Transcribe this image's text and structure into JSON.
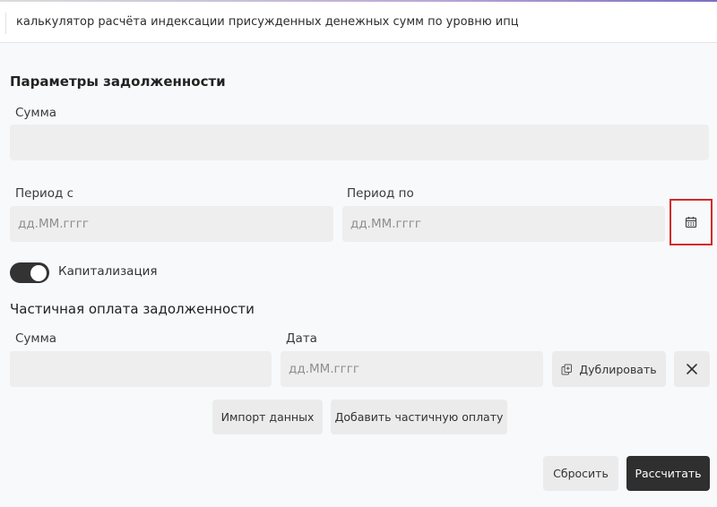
{
  "header": {
    "title": "калькулятор расчёта индексации присужденных денежных сумм по уровню ипц"
  },
  "debt_params": {
    "title": "Параметры задолженности",
    "sum_label": "Сумма",
    "sum_value": "",
    "period_from_label": "Период с",
    "period_from_placeholder": "дд.ММ.гггг",
    "period_to_label": "Период по",
    "period_to_placeholder": "дд.ММ.гггг",
    "calendar_icon": "calendar-icon"
  },
  "capitalization": {
    "label": "Капитализация",
    "enabled": true
  },
  "partial_payment": {
    "title": "Частичная оплата задолженности",
    "sum_label": "Сумма",
    "sum_value": "",
    "date_label": "Дата",
    "date_placeholder": "дд.ММ.гггг",
    "duplicate_label": "Дублировать",
    "duplicate_icon": "copy-icon",
    "remove_icon": "close-icon",
    "import_label": "Импорт данных",
    "add_label": "Добавить частичную оплату"
  },
  "actions": {
    "reset_label": "Сбросить",
    "calculate_label": "Рассчитать"
  },
  "colors": {
    "highlight": "#d42a2a",
    "primary_button": "#2f2f2f",
    "field_background": "#eeeeef"
  }
}
